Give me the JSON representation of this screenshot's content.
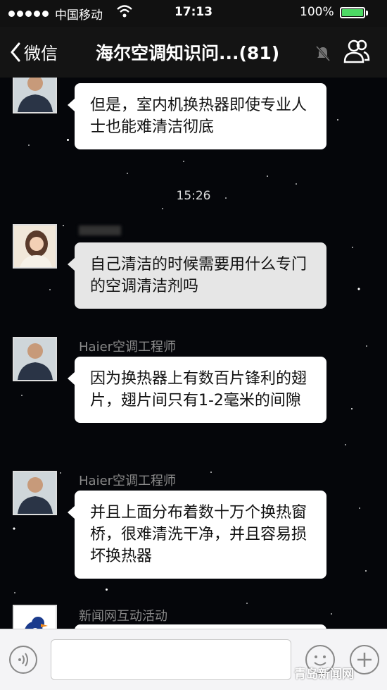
{
  "status_bar": {
    "carrier": "中国移动",
    "time": "17:13",
    "battery": "100%"
  },
  "nav": {
    "back_label": "微信",
    "title": "海尔空调知识问...(81)"
  },
  "chat": {
    "timestamp": "15:26",
    "messages": [
      {
        "sender": "",
        "text": "但是，室内机换热器即使专业人士也能难清洁彻底"
      },
      {
        "sender": "",
        "text": "自己清洁的时候需要用什么专门的空调清洁剂吗"
      },
      {
        "sender": "Haier空调工程师",
        "text": "因为换热器上有数百片锋利的翅片，翅片间只有1-2毫米的间隙"
      },
      {
        "sender": "Haier空调工程师",
        "text": "并且上面分布着数十万个换热窗桥，很难清洗干净，并且容易损坏换热器"
      },
      {
        "sender": "新闻网互动活动",
        "text": ""
      }
    ]
  },
  "input_bar": {
    "placeholder": ""
  },
  "watermark": "青岛新闻网"
}
